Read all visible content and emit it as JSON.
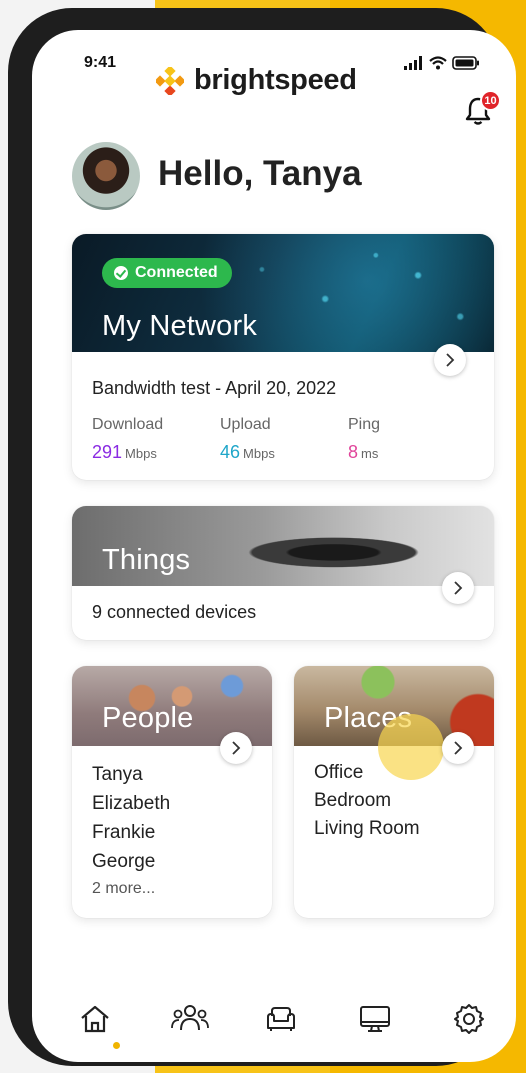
{
  "status_bar": {
    "time": "9:41"
  },
  "brand": {
    "name": "brightspeed",
    "accent": "#f7c318"
  },
  "notifications": {
    "count": "10"
  },
  "greeting": "Hello, Tanya",
  "network_card": {
    "status": "Connected",
    "title": "My Network",
    "bandwidth_title": "Bandwidth test - April 20, 2022",
    "download": {
      "label": "Download",
      "value": "291",
      "unit": "Mbps",
      "color": "#8a2be2"
    },
    "upload": {
      "label": "Upload",
      "value": "46",
      "unit": "Mbps",
      "color": "#1fa6c9"
    },
    "ping": {
      "label": "Ping",
      "value": "8",
      "unit": "ms",
      "color": "#e0449a"
    }
  },
  "things_card": {
    "title": "Things",
    "subtitle": "9 connected devices"
  },
  "people_card": {
    "title": "People",
    "items": [
      "Tanya",
      "Elizabeth",
      "Frankie",
      "George"
    ],
    "more": "2 more..."
  },
  "places_card": {
    "title": "Places",
    "items": [
      "Office",
      "Bedroom",
      "Living Room"
    ]
  },
  "bottom_nav": {
    "items": [
      {
        "icon": "home-icon",
        "active": true
      },
      {
        "icon": "people-icon",
        "active": false
      },
      {
        "icon": "couch-icon",
        "active": false
      },
      {
        "icon": "monitor-icon",
        "active": false
      },
      {
        "icon": "gear-icon",
        "active": false
      }
    ]
  }
}
